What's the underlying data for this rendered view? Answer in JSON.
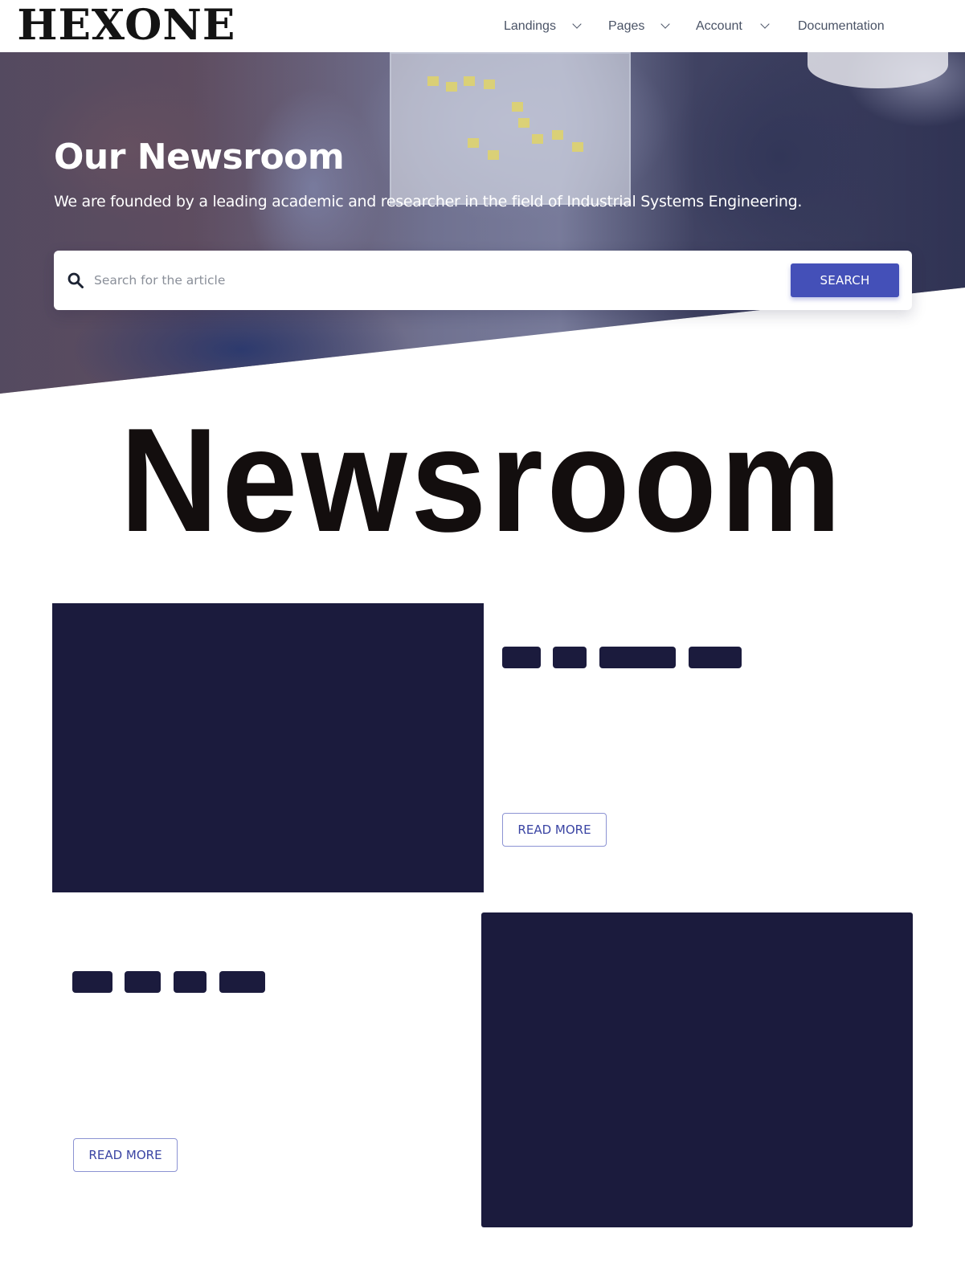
{
  "navbar": {
    "logo_text": "HEXONE",
    "menu": [
      {
        "label": "Landings",
        "has_dropdown": true
      },
      {
        "label": "Pages",
        "has_dropdown": true
      },
      {
        "label": "Account",
        "has_dropdown": true
      },
      {
        "label": "Documentation",
        "has_dropdown": false
      }
    ]
  },
  "hero": {
    "title": "Our Newsroom",
    "subtitle": "We are founded by a leading academic and researcher in the field of Industrial Systems Engineering.",
    "overlay_color": "#28306e"
  },
  "search": {
    "icon": "search-icon",
    "placeholder": "Search for the article",
    "value": "",
    "button_label": "SEARCH",
    "button_color": "#4450b8"
  },
  "section": {
    "heading": "Newsroom"
  },
  "articles": [
    {
      "read_more_label": "READ MORE",
      "placeholder_color": "#1b1b3d"
    },
    {
      "read_more_label": "READ MORE",
      "placeholder_color": "#1b1b3d"
    }
  ]
}
